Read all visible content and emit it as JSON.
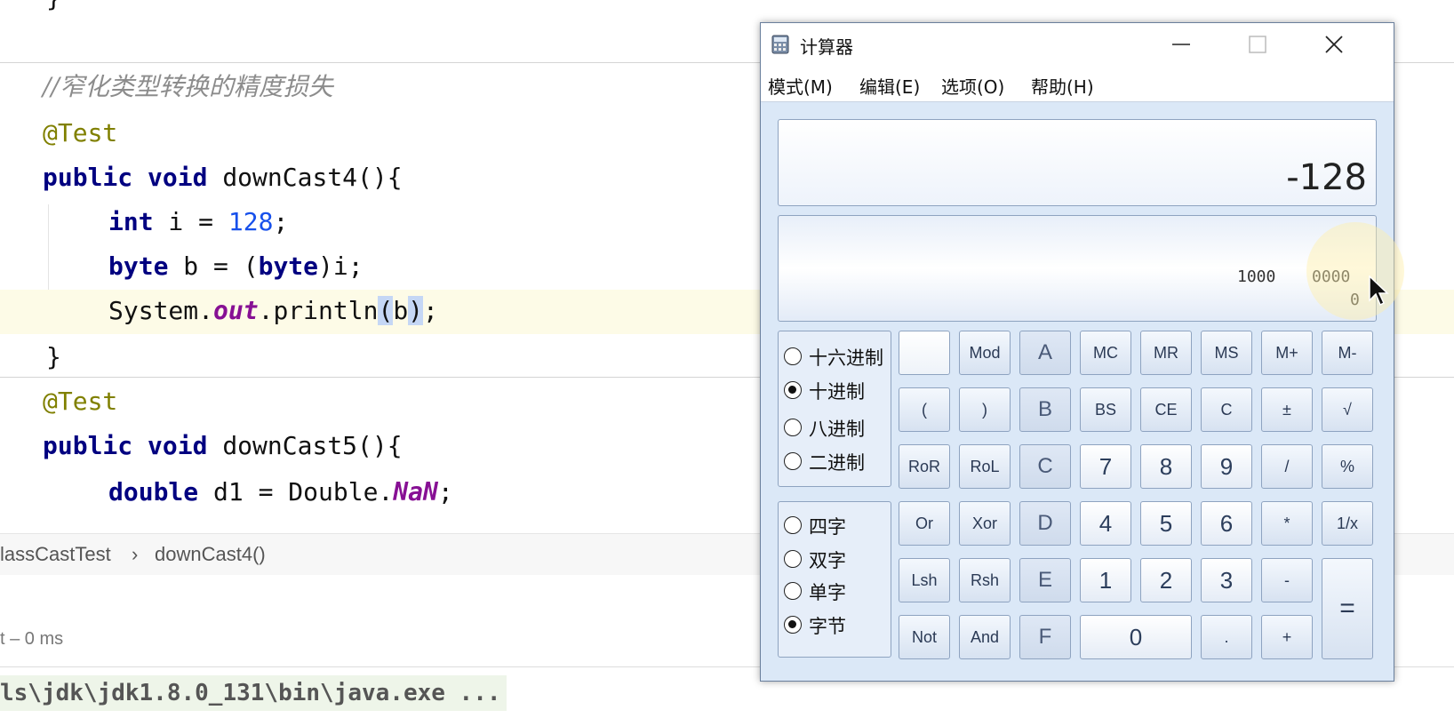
{
  "editor": {
    "closing_brace_top": "}",
    "comment": "//窄化类型转换的精度损失",
    "annotation1": "@Test",
    "method1_kw1": "public",
    "method1_kw2": "void",
    "method1_name": "downCast4(){",
    "line_int_kw": "int",
    "line_int_rest": " i = ",
    "line_int_num": "128",
    "line_int_end": ";",
    "line_byte_kw": "byte",
    "line_byte_mid": " b = (",
    "line_byte_kw2": "byte",
    "line_byte_end": ")i;",
    "line_print_pre": "System.",
    "line_print_field": "out",
    "line_print_mid": ".println",
    "line_print_paren_open": "(",
    "line_print_arg": "b",
    "line_print_paren_close": ")",
    "line_print_end": ";",
    "closing_brace": "}",
    "annotation2": "@Test",
    "method2_kw1": "public",
    "method2_kw2": "void",
    "method2_name": "downCast5(){",
    "line_double_kw": "double",
    "line_double_rest": " d1 = Double.",
    "line_double_field": "NaN",
    "line_double_end": ";"
  },
  "breadcrumb": {
    "class": "lassCastTest",
    "separator": "›",
    "method": "downCast4()"
  },
  "run": {
    "status": "t – 0 ms",
    "console_text": "ls\\jdk\\jdk1.8.0_131\\bin\\java.exe ..."
  },
  "calculator": {
    "title": "计算器",
    "menu": [
      "模式(M)",
      "编辑(E)",
      "选项(O)",
      "帮助(H)"
    ],
    "display_value": "-128",
    "binary_groups": [
      "1000",
      "0000"
    ],
    "binary_row2": "0",
    "base_options": [
      "十六进制",
      "十进制",
      "八进制",
      "二进制"
    ],
    "base_selected": "十进制",
    "word_options": [
      "四字",
      "双字",
      "单字",
      "字节"
    ],
    "word_selected": "字节",
    "keys": {
      "mod": "Mod",
      "a": "A",
      "mc": "MC",
      "mr": "MR",
      "ms": "MS",
      "mplus": "M+",
      "mminus": "M-",
      "lparen": "(",
      "rparen": ")",
      "b": "B",
      "bs": "BS",
      "ce": "CE",
      "c": "C",
      "pm": "±",
      "sqrt": "√",
      "ror": "RoR",
      "rol": "RoL",
      "hc": "C",
      "n7": "7",
      "n8": "8",
      "n9": "9",
      "div": "/",
      "pct": "%",
      "or": "Or",
      "xor": "Xor",
      "d": "D",
      "n4": "4",
      "n5": "5",
      "n6": "6",
      "mul": "*",
      "recip": "1/x",
      "lsh": "Lsh",
      "rsh": "Rsh",
      "e": "E",
      "n1": "1",
      "n2": "2",
      "n3": "3",
      "sub": "-",
      "eq": "=",
      "not": "Not",
      "and": "And",
      "f": "F",
      "n0": "0",
      "dot": ".",
      "add": "+"
    }
  }
}
